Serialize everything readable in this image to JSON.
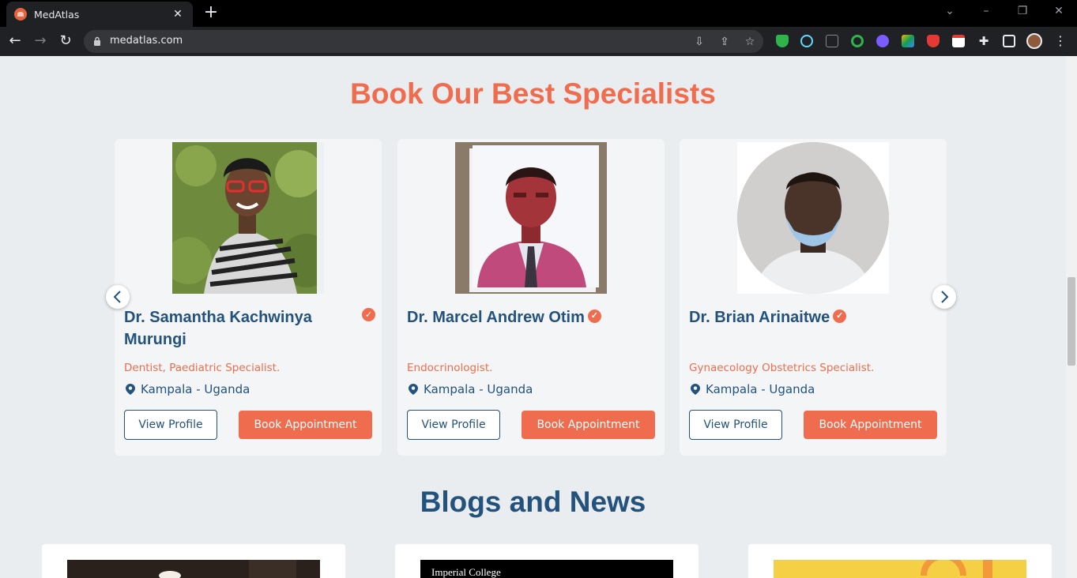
{
  "browser": {
    "tab_title": "MedAtlas",
    "url": "medatlas.com"
  },
  "specialists": {
    "title": "Book Our Best Specialists",
    "view_label": "View Profile",
    "book_label": "Book Appointment",
    "doctors": [
      {
        "name": "Dr. Samantha Kachwinya Murungi",
        "specialty": "Dentist, Paediatric Specialist.",
        "location": "Kampala - Uganda"
      },
      {
        "name": "Dr. Marcel Andrew Otim",
        "specialty": "Endocrinologist.",
        "location": "Kampala - Uganda"
      },
      {
        "name": "Dr. Brian Arinaitwe",
        "specialty": "Gynaecology Obstetrics Specialist.",
        "location": "Kampala - Uganda"
      }
    ]
  },
  "blogs": {
    "title": "Blogs and News",
    "items": [
      {
        "image_text": ""
      },
      {
        "image_text": "Imperial College"
      },
      {
        "image_text": ""
      }
    ]
  },
  "colors": {
    "accent": "#ef6d4e",
    "primary": "#23527c",
    "background": "#e9edf0"
  }
}
